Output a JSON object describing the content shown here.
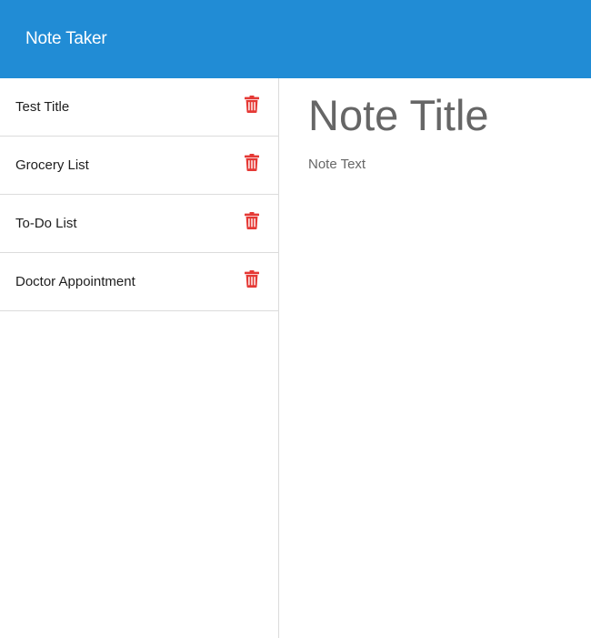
{
  "navbar": {
    "brand": "Note Taker",
    "color": "#218cd5"
  },
  "sidebar": {
    "notes": [
      {
        "title": "Test Title",
        "delete_icon": "trash-icon"
      },
      {
        "title": "Grocery List",
        "delete_icon": "trash-icon"
      },
      {
        "title": "To-Do List",
        "delete_icon": "trash-icon"
      },
      {
        "title": "Doctor Appointment",
        "delete_icon": "trash-icon"
      }
    ],
    "delete_color": "#e53935"
  },
  "editor": {
    "title_placeholder": "Note Title",
    "text_placeholder": "Note Text"
  }
}
